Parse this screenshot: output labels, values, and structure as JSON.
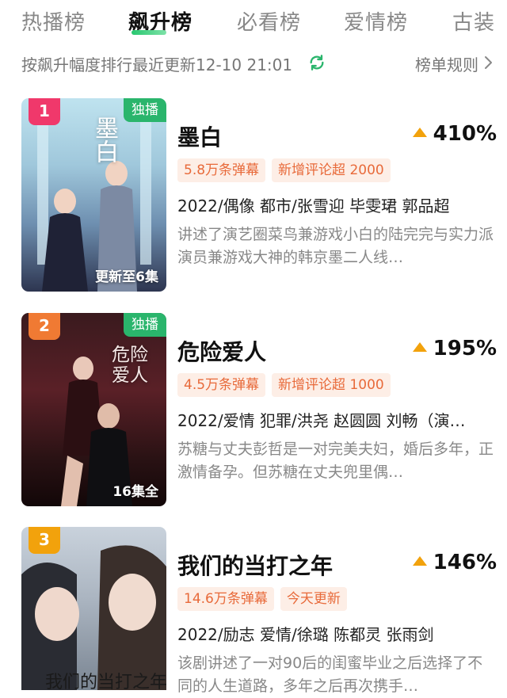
{
  "tabs": [
    {
      "label": "热播榜",
      "active": false
    },
    {
      "label": "飙升榜",
      "active": true
    },
    {
      "label": "必看榜",
      "active": false
    },
    {
      "label": "爱情榜",
      "active": false
    },
    {
      "label": "古装",
      "active": false
    }
  ],
  "subheader": {
    "sort_text": "按飙升幅度排行最近更新12-10 21:01",
    "rules_label": "榜单规则"
  },
  "items": [
    {
      "rank": "1",
      "exclusive": "独播",
      "episode": "更新至6集",
      "poster_text": "墨白",
      "title": "墨白",
      "growth": "410%",
      "tags": [
        "5.8万条弹幕",
        "新增评论超 2000"
      ],
      "meta": "2022/偶像 都市/张雪迎 毕雯珺 郭品超",
      "desc": "讲述了演艺圈菜鸟兼游戏小白的陆完完与实力派演员兼游戏大神的韩京墨二人线…"
    },
    {
      "rank": "2",
      "exclusive": "独播",
      "episode": "16集全",
      "poster_text": "危险爱人",
      "title": "危险爱人",
      "growth": "195%",
      "tags": [
        "4.5万条弹幕",
        "新增评论超 1000"
      ],
      "meta": "2022/爱情 犯罪/洪尧 赵圆圆 刘畅（演…",
      "desc": "苏糖与丈夫彭哲是一对完美夫妇，婚后多年，正激情备孕。但苏糖在丈夫兜里偶…"
    },
    {
      "rank": "3",
      "exclusive": "",
      "episode": "",
      "poster_text": "我们的当打之年",
      "title": "我们的当打之年",
      "growth": "146%",
      "tags": [
        "14.6万条弹幕",
        "今天更新"
      ],
      "meta": "2022/励志 爱情/徐璐 陈都灵 张雨剑",
      "desc": "该剧讲述了一对90后的闺蜜毕业之后选择了不同的人生道路，多年之后再次携手…"
    }
  ],
  "colors": {
    "accent_green": "#2ab56c",
    "tag_bg": "#fdeee6",
    "tag_text": "#e86a3a",
    "rank1": "#f0386b",
    "rank2": "#f07a33",
    "rank3": "#f2a20c",
    "growth_triangle": "#f2a20c"
  }
}
